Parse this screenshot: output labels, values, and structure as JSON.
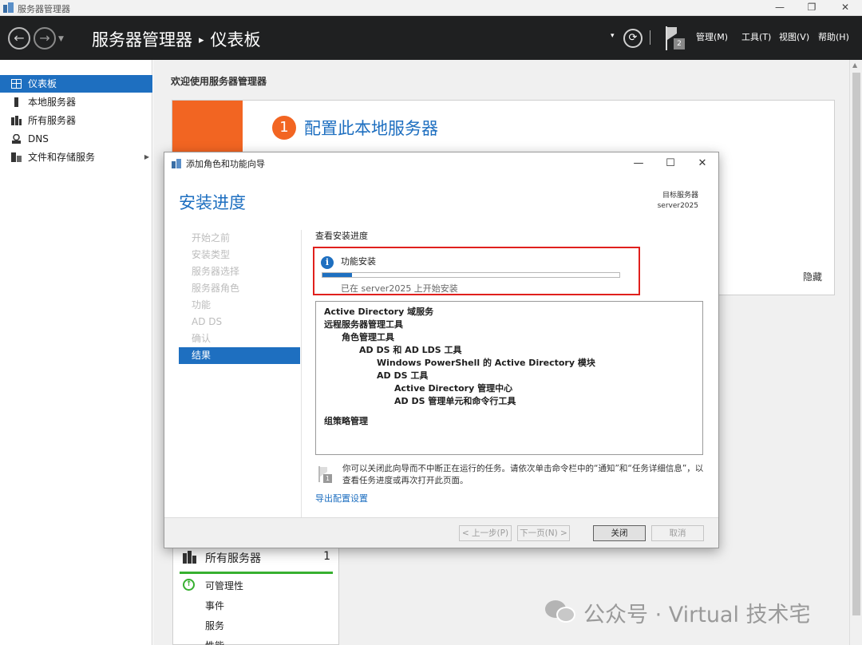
{
  "window": {
    "title": "服务器管理器",
    "minimize_glyph": "—",
    "restore_glyph": "❐",
    "close_glyph": "✕"
  },
  "header": {
    "back_glyph": "←",
    "forward_glyph": "→",
    "dropdown_glyph": "▼",
    "breadcrumb_root": "服务器管理器",
    "breadcrumb_separator": "▸",
    "breadcrumb_current": "仪表板",
    "refresh_dropdown_glyph": "▾",
    "refresh_glyph": "⟳",
    "notification_count": "2",
    "menu": {
      "manage": "管理(M)",
      "tools": "工具(T)",
      "view": "视图(V)",
      "help": "帮助(H)"
    }
  },
  "sidebar": {
    "items": [
      {
        "label": "仪表板",
        "icon": "dashboard-icon",
        "active": true
      },
      {
        "label": "本地服务器",
        "icon": "server-icon"
      },
      {
        "label": "所有服务器",
        "icon": "servers-icon"
      },
      {
        "label": "DNS",
        "icon": "dns-icon"
      },
      {
        "label": "文件和存储服务",
        "icon": "storage-icon",
        "expand_glyph": "▶"
      }
    ]
  },
  "main": {
    "welcome": "欢迎使用服务器管理器",
    "step_number": "1",
    "step_text": "配置此本地服务器",
    "hide_link": "隐藏",
    "tile": {
      "title": "所有服务器",
      "count": "1",
      "rows": [
        "可管理性",
        "事件",
        "服务",
        "性能"
      ],
      "check_glyph": "↑"
    }
  },
  "dialog": {
    "title": "添加角色和功能向导",
    "heading": "安装进度",
    "target_label": "目标服务器",
    "target_server": "server2025",
    "steps": [
      "开始之前",
      "安装类型",
      "服务器选择",
      "服务器角色",
      "功能",
      "AD DS",
      "确认",
      "结果"
    ],
    "current_step_index": 7,
    "view_progress": "查看安装进度",
    "progress": {
      "info_glyph": "i",
      "label": "功能安装",
      "fraction": 0.1,
      "status": "已在 server2025 上开始安装"
    },
    "results": [
      {
        "text": "Active Directory 域服务",
        "level": 0
      },
      {
        "text": "远程服务器管理工具",
        "level": 0
      },
      {
        "text": "角色管理工具",
        "level": 1
      },
      {
        "text": "AD DS 和 AD LDS 工具",
        "level": 2
      },
      {
        "text": "Windows PowerShell 的 Active Directory 模块",
        "level": 3
      },
      {
        "text": "AD DS 工具",
        "level": 3
      },
      {
        "text": "Active Directory 管理中心",
        "level": 4
      },
      {
        "text": "AD DS 管理单元和命令行工具",
        "level": 4
      },
      {
        "text": "组策略管理",
        "level": 0
      }
    ],
    "note_badge": "1",
    "note": "你可以关闭此向导而不中断正在运行的任务。请依次单击命令栏中的“通知”和“任务详细信息”，以查看任务进度或再次打开此页面。",
    "export_link": "导出配置设置",
    "buttons": {
      "previous": "< 上一步(P)",
      "next": "下一页(N) >",
      "close": "关闭",
      "cancel": "取消"
    }
  },
  "watermark": {
    "text": "公众号 · Virtual 技术宅"
  }
}
